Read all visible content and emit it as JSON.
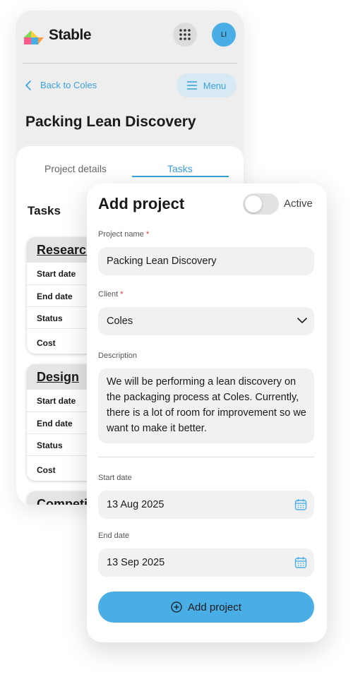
{
  "header": {
    "brand": "Stable",
    "avatar_initials": "LI",
    "logo_icon": "stable-logo-icon",
    "apps_icon": "grid-dots-icon"
  },
  "nav": {
    "back_label": "Back to Coles",
    "menu_label": "Menu"
  },
  "page": {
    "title": "Packing Lean Discovery"
  },
  "tabs": [
    {
      "label": "Project details",
      "active": false
    },
    {
      "label": "Tasks",
      "active": true
    }
  ],
  "tasks": {
    "heading": "Tasks",
    "items": [
      {
        "name": "Research",
        "rows": [
          "Start date",
          "End date",
          "Status",
          "Cost"
        ]
      },
      {
        "name": "Design",
        "rows": [
          "Start date",
          "End date",
          "Status",
          "Cost"
        ]
      },
      {
        "name": "Competi",
        "rows": []
      }
    ]
  },
  "form": {
    "title": "Add project",
    "active_label": "Active",
    "active_on": false,
    "project_name_label": "Project name",
    "project_name_value": "Packing Lean Discovery",
    "client_label": "Client",
    "client_value": "Coles",
    "description_label": "Description",
    "description_value": "We will be performing a lean discovery on the packaging process at Coles. Currently, there is a lot of room for improvement so we want to make it better.",
    "start_date_label": "Start date",
    "start_date_value": "13 Aug 2025",
    "end_date_label": "End date",
    "end_date_value": "13 Sep 2025",
    "required_mark": "*",
    "submit_label": "Add project"
  },
  "colors": {
    "accent": "#4aaee6",
    "link": "#3aa0dc",
    "required": "#e0303a"
  }
}
